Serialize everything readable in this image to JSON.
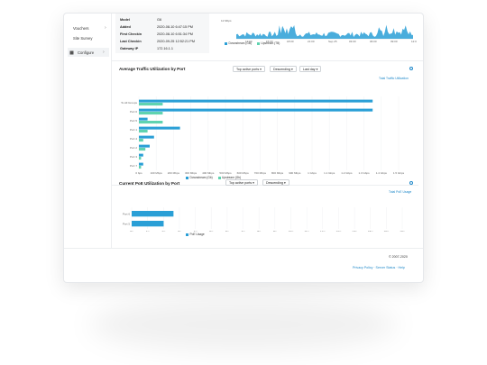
{
  "sidebar": {
    "items": [
      {
        "label": "Vouchers"
      },
      {
        "label": "Site Survey"
      },
      {
        "label": "Configure"
      }
    ]
  },
  "device_info": {
    "rows": [
      {
        "key": "Model",
        "value": "G6"
      },
      {
        "key": "Added",
        "value": "2020-08-10 6:47:15 PM"
      },
      {
        "key": "First Checkin",
        "value": "2020-08-10 6:51:34 PM"
      },
      {
        "key": "Last Checkin",
        "value": "2020-09-25 12:52:21 PM"
      },
      {
        "key": "Gateway IP",
        "value": "172.16.1.1"
      }
    ]
  },
  "top_chart": {
    "ylabel": "12 Mbps",
    "legend": [
      "Downstream (GB)",
      "Upstream (TB)"
    ]
  },
  "traffic_card": {
    "title": "Average Traffic Utilization by Port",
    "dropdowns": [
      "Top active ports",
      "Descending",
      "Last day"
    ],
    "link": "Total Traffic Utilization",
    "legend": [
      "Downstream (Gb)",
      "Upstream (Gb)"
    ]
  },
  "poe_card": {
    "title": "Current PoE Utilization by Port",
    "dropdowns": [
      "Top active ports",
      "Descending"
    ],
    "link": "Total PoE Usage",
    "legend": [
      "PoE Usage"
    ]
  },
  "colors": {
    "downstream": "#2a9fd6",
    "upstream": "#5fd3b0",
    "poe": "#2a9fd6"
  },
  "chart_data": [
    {
      "type": "bar",
      "title": "Average Traffic Utilization by Port",
      "orientation": "horizontal",
      "categories": [
        "To All Groups",
        "Port 6",
        "Port 5",
        "Port 1",
        "Port 4",
        "Port 2",
        "Port 3",
        "Port 7"
      ],
      "series": [
        {
          "name": "Downstream (Gb)",
          "values": [
            1.08,
            1.08,
            0.04,
            0.19,
            0.07,
            0.05,
            0.02,
            0.02
          ]
        },
        {
          "name": "Upstream (Gb)",
          "values": [
            0.11,
            0.11,
            0.11,
            0.04,
            0.02,
            0.03,
            0.01,
            0.01
          ]
        }
      ],
      "xlim": [
        0,
        1.2
      ],
      "xticks": [
        "0 bps",
        "100 Mbps",
        "200 Mbps",
        "300 Mbps",
        "400 Mbps",
        "500 Mbps",
        "600 Mbps",
        "700 Mbps",
        "800 Mbps",
        "900 Mbps",
        "1 Gbps",
        "1.1 Gbps",
        "1.2 Gbps",
        "1.3 Gbps",
        "1.4 Gbps",
        "1.5 Gbps"
      ]
    },
    {
      "type": "bar",
      "title": "Current PoE Utilization by Port",
      "orientation": "horizontal",
      "categories": [
        "Port 6",
        "Port 5"
      ],
      "series": [
        {
          "name": "PoE Usage",
          "values": [
            3.4,
            2.6
          ]
        }
      ],
      "xlim": [
        0,
        22
      ],
      "xticks": [
        "0w",
        "1w",
        "2w",
        "3w",
        "4w",
        "5w",
        "6w",
        "7w",
        "8w",
        "9w",
        "10w",
        "11w",
        "12w",
        "13w",
        "14w",
        "15w",
        "16w",
        "17w"
      ]
    }
  ],
  "footer": {
    "copyright": "© 2007-2020",
    "links": "Privacy Policy · Server Status · Help"
  }
}
